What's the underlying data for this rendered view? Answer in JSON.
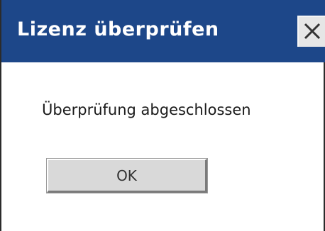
{
  "dialog": {
    "title": "Lizenz überprüfen",
    "close_icon": "close-icon",
    "message": "Überprüfung abgeschlossen",
    "ok_label": "OK"
  },
  "colors": {
    "titlebar": "#1d4789",
    "title_text": "#ffffff",
    "body_background": "#ffffff",
    "button_face": "#d9d9d9"
  }
}
